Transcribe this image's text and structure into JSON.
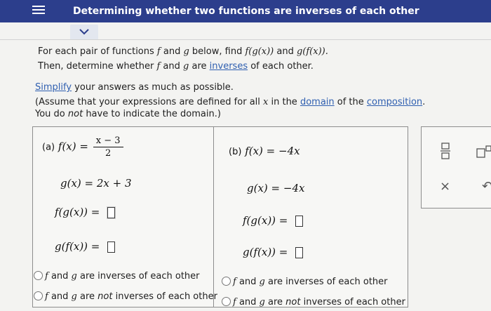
{
  "header": {
    "title": "Determining whether two functions are inverses of each other"
  },
  "prompt": {
    "line1": {
      "pre": "For each pair of functions ",
      "f": "f",
      "and": " and ",
      "g": "g",
      "mid": " below, find ",
      "expr1": "f(g(x))",
      "and2": " and ",
      "expr2": "g(f(x)).",
      "end": ""
    },
    "line2": {
      "pre": "Then, determine whether ",
      "f": "f",
      "and": " and ",
      "g": "g",
      "are": " are ",
      "link": "inverses",
      "post": " of each other."
    },
    "line3": {
      "link": "Simplify",
      "post": " your answers as much as possible."
    },
    "line4": {
      "pre": "(Assume that your expressions are defined for all ",
      "x": "x",
      "mid": " in the ",
      "link1": "domain",
      "mid2": " of the ",
      "link2": "composition",
      "post": "."
    },
    "line5": {
      "pre": "You do ",
      "not": "not",
      "post": " have to indicate the domain.)"
    }
  },
  "part_a": {
    "label": "(a)",
    "f_lhs": "f(x) = ",
    "f_num": "x − 3",
    "f_den": "2",
    "g_eq": "g(x) = 2x + 3",
    "fg_lhs": "f(g(x)) = ",
    "gf_lhs": "g(f(x)) = ",
    "opt1": {
      "f": "f",
      "and": " and ",
      "g": "g",
      "post": " are inverses of each other"
    },
    "opt2": {
      "f": "f",
      "and": " and ",
      "g": "g",
      "are": " are ",
      "not": "not",
      "post": " inverses of each other"
    }
  },
  "part_b": {
    "label": "(b)",
    "f_eq": "f(x) = −4x",
    "g_eq": "g(x) = −4x",
    "fg_lhs": "f(g(x)) = ",
    "gf_lhs": "g(f(x)) = ",
    "opt1": {
      "f": "f",
      "and": " and ",
      "g": "g",
      "post": " are inverses of each other"
    },
    "opt2": {
      "f": "f",
      "and": " and ",
      "g": "g",
      "are": " are ",
      "not": "not",
      "post": " inverses of each other"
    }
  },
  "toolbar": {
    "fraction_icon": "fraction-icon",
    "exponent_icon": "exponent-icon",
    "clear_symbol": "×",
    "undo_symbol": "↶"
  },
  "colors": {
    "header_bg": "#2c3e8c",
    "link": "#2f5fb0"
  }
}
